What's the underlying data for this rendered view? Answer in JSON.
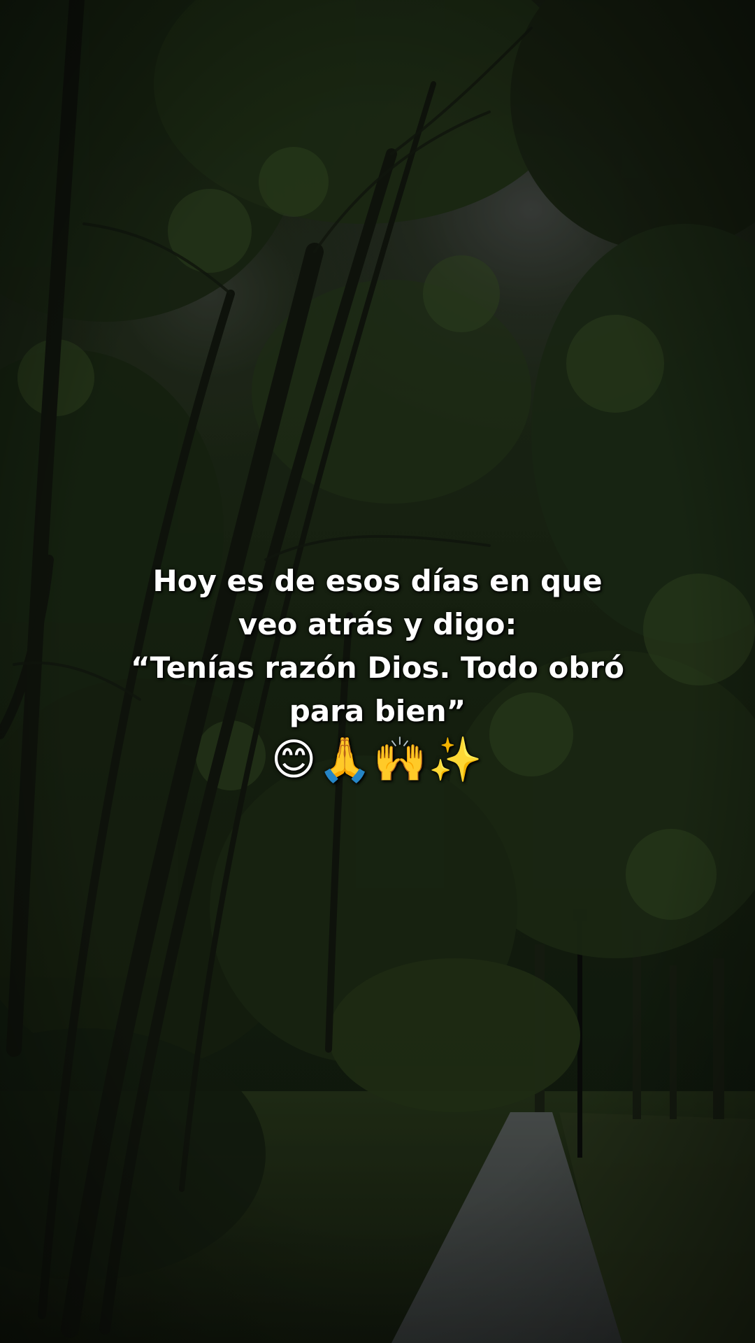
{
  "quote": {
    "line1": "Hoy es de esos días en que",
    "line2": "veo atrás y digo:",
    "line3": "“Tenías razón Dios. Todo obró",
    "line4": "para bien”",
    "emojis": "😊🙏🙌✨"
  },
  "colors": {
    "text": "#ffffff",
    "foliage_dark": "#1a2414",
    "foliage_mid": "#2e4220",
    "sky": "#4a4f4a",
    "path": "#4e5452"
  }
}
